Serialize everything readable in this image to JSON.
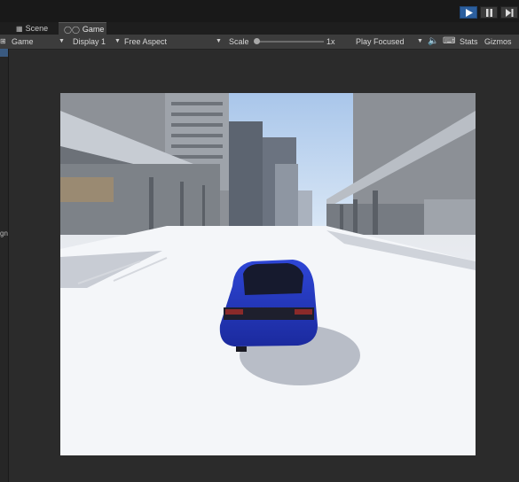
{
  "playbar": {
    "play": "play-icon",
    "pause": "pause-icon",
    "step": "step-icon",
    "active_color": "#2c5f9e"
  },
  "tabs": [
    {
      "label": "Scene",
      "icon": "grid-icon"
    },
    {
      "label": "Game",
      "icon": "gamepad-icon",
      "active": true
    }
  ],
  "toolbar": {
    "game_dropdown": "Game",
    "display": "Display 1",
    "aspect": "Free Aspect",
    "scale_label": "Scale",
    "scale_value": "1x",
    "play_mode": "Play Focused",
    "mute_icon": "speaker-icon",
    "keyboard_icon": "keyboard-icon",
    "stats": "Stats",
    "gizmos": "Gizmos"
  },
  "left_panel": {
    "fragment": "gn"
  },
  "game_view": {
    "scene_description_icon": "city-street-scene",
    "sky_color": "#b5d0ee",
    "car_color": "#2130b5"
  }
}
